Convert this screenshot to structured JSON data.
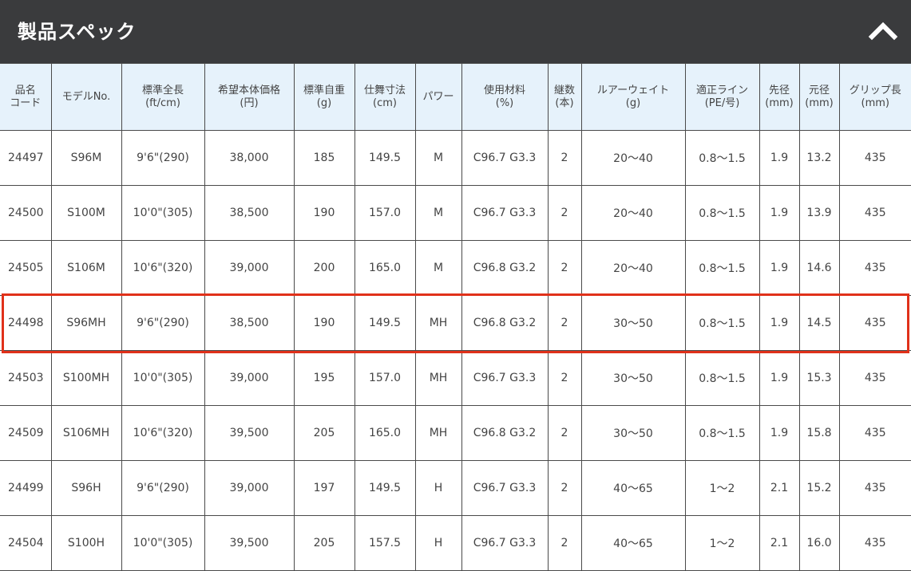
{
  "header": {
    "title": "製品スペック",
    "toggle_icon": "chevron-up-icon"
  },
  "table": {
    "headers": [
      {
        "line1": "品名",
        "line2": "コード"
      },
      {
        "line1": "モデルNo.",
        "line2": ""
      },
      {
        "line1": "標準全長",
        "line2": "(ft/cm)"
      },
      {
        "line1": "希望本体価格",
        "line2": "(円)"
      },
      {
        "line1": "標準自重",
        "line2": "(g)"
      },
      {
        "line1": "仕舞寸法",
        "line2": "(cm)"
      },
      {
        "line1": "パワー",
        "line2": ""
      },
      {
        "line1": "使用材料",
        "line2": "(%)"
      },
      {
        "line1": "継数",
        "line2": "(本)"
      },
      {
        "line1": "ルアーウェイト",
        "line2": "(g)"
      },
      {
        "line1": "適正ライン",
        "line2": "(PE/号)"
      },
      {
        "line1": "先径",
        "line2": "(mm)"
      },
      {
        "line1": "元径",
        "line2": "(mm)"
      },
      {
        "line1": "グリップ長",
        "line2": "(mm)"
      }
    ],
    "rows": [
      [
        "24497",
        "S96M",
        "9'6\"(290)",
        "38,000",
        "185",
        "149.5",
        "M",
        "C96.7 G3.3",
        "2",
        "20～40",
        "0.8～1.5",
        "1.9",
        "13.2",
        "435"
      ],
      [
        "24500",
        "S100M",
        "10'0\"(305)",
        "38,500",
        "190",
        "157.0",
        "M",
        "C96.7 G3.3",
        "2",
        "20～40",
        "0.8～1.5",
        "1.9",
        "13.9",
        "435"
      ],
      [
        "24505",
        "S106M",
        "10'6\"(320)",
        "39,000",
        "200",
        "165.0",
        "M",
        "C96.8 G3.2",
        "2",
        "20～40",
        "0.8～1.5",
        "1.9",
        "14.6",
        "435"
      ],
      [
        "24498",
        "S96MH",
        "9'6\"(290)",
        "38,500",
        "190",
        "149.5",
        "MH",
        "C96.8 G3.2",
        "2",
        "30～50",
        "0.8～1.5",
        "1.9",
        "14.5",
        "435"
      ],
      [
        "24503",
        "S100MH",
        "10'0\"(305)",
        "39,000",
        "195",
        "157.0",
        "MH",
        "C96.7 G3.3",
        "2",
        "30～50",
        "0.8～1.5",
        "1.9",
        "15.3",
        "435"
      ],
      [
        "24509",
        "S106MH",
        "10'6\"(320)",
        "39,500",
        "205",
        "165.0",
        "MH",
        "C96.8 G3.2",
        "2",
        "30～50",
        "0.8～1.5",
        "1.9",
        "15.8",
        "435"
      ],
      [
        "24499",
        "S96H",
        "9'6\"(290)",
        "39,000",
        "197",
        "149.5",
        "H",
        "C96.7 G3.3",
        "2",
        "40～65",
        "1～2",
        "2.1",
        "15.2",
        "435"
      ],
      [
        "24504",
        "S100H",
        "10'0\"(305)",
        "39,500",
        "205",
        "157.5",
        "H",
        "C96.7 G3.3",
        "2",
        "40～65",
        "1～2",
        "2.1",
        "16.0",
        "435"
      ]
    ],
    "highlighted_row_code": "24498"
  },
  "colors": {
    "header_bg": "#3a3b3d",
    "table_header_bg": "#e6f2fb",
    "highlight_border": "#e0311a"
  }
}
